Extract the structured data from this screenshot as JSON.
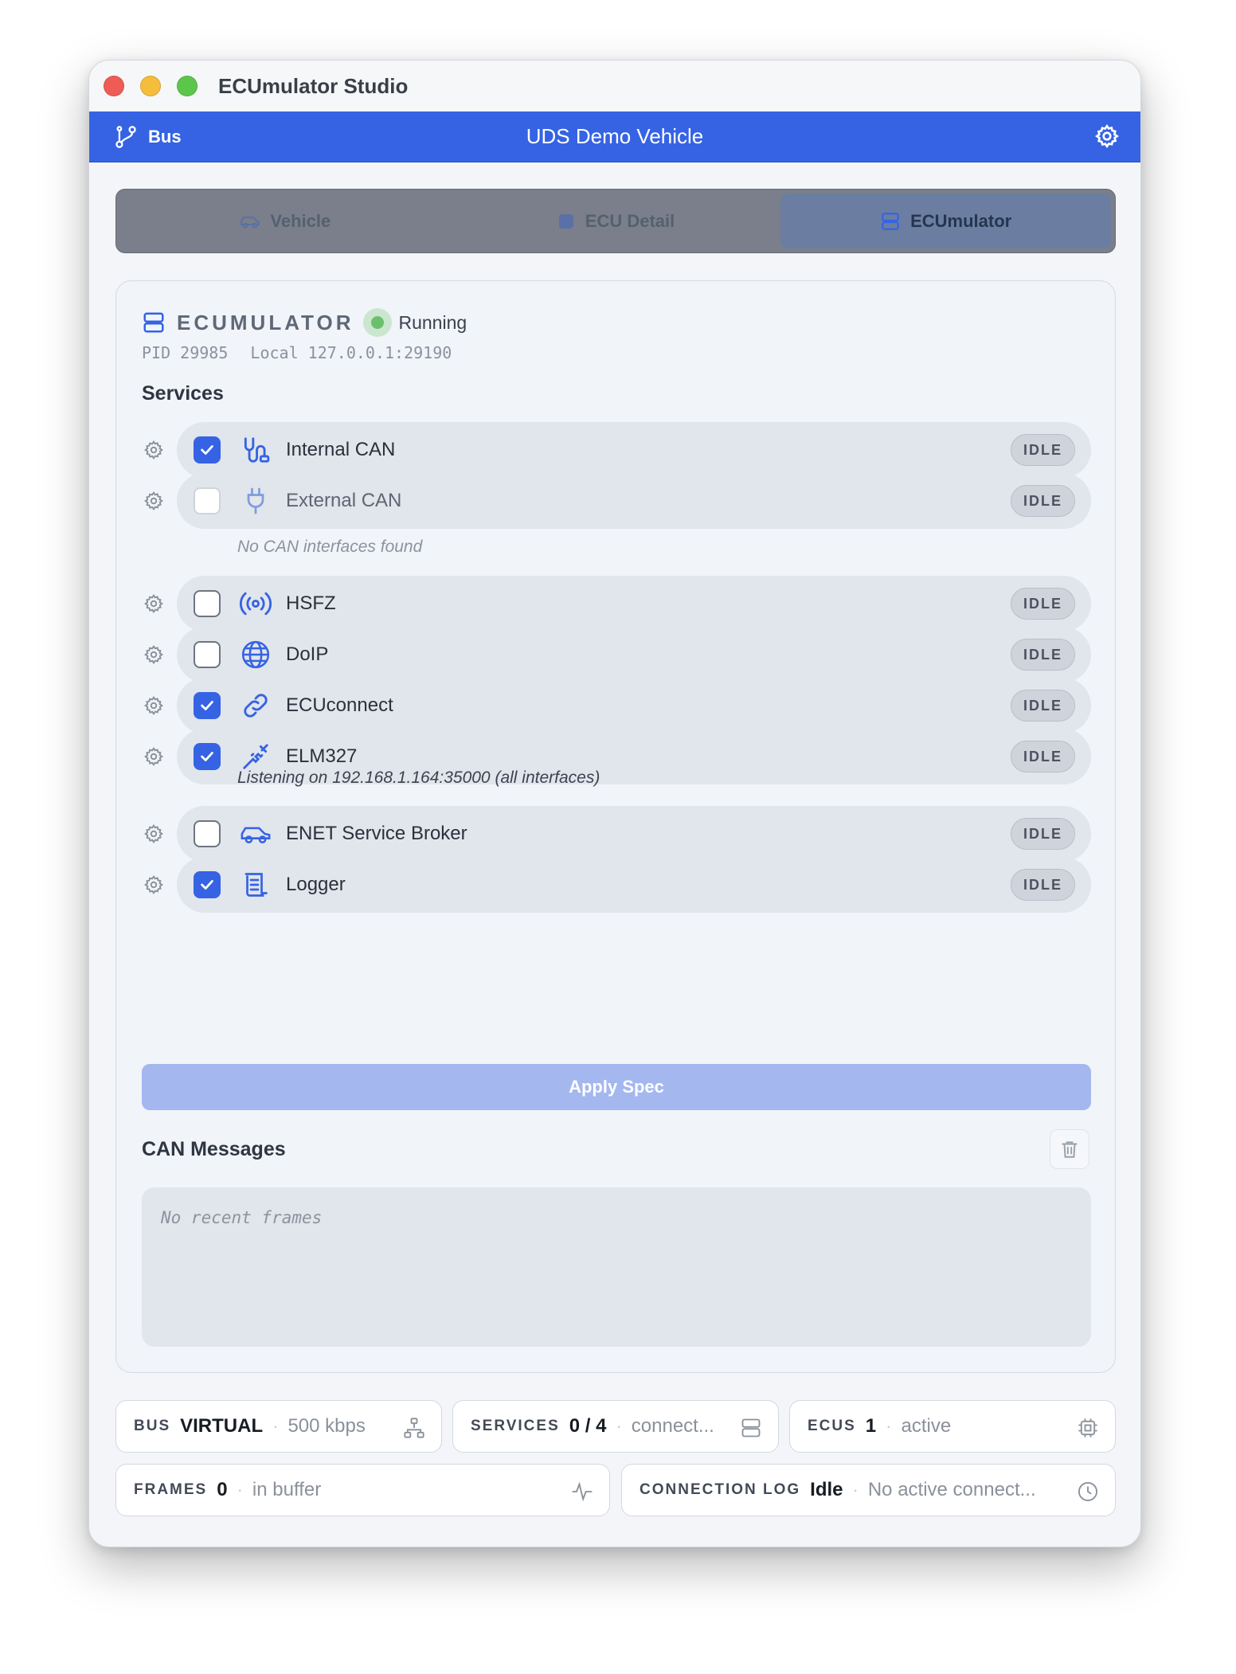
{
  "window": {
    "title": "ECUmulator Studio"
  },
  "header": {
    "bus_label": "Bus",
    "vehicle_name": "UDS Demo Vehicle"
  },
  "tabs": [
    {
      "label": "Vehicle",
      "icon": "car-icon",
      "active": false
    },
    {
      "label": "ECU Detail",
      "icon": "chip-icon",
      "active": false
    },
    {
      "label": "ECUmulator",
      "icon": "server-icon",
      "active": true
    }
  ],
  "ecumulator": {
    "title": "ECUMULATOR",
    "status": "Running",
    "status_color": "#6cbf6c",
    "pid": "PID 29985",
    "local": "Local 127.0.0.1:29190"
  },
  "services_title": "Services",
  "services": [
    {
      "name": "Internal CAN",
      "checked": true,
      "state": "IDLE",
      "icon": "can-plug-icon"
    },
    {
      "name": "External CAN",
      "checked": false,
      "disabled": true,
      "state": "IDLE",
      "icon": "plug-icon",
      "note": "No CAN interfaces found"
    },
    {
      "name": "HSFZ",
      "checked": false,
      "state": "IDLE",
      "icon": "broadcast-icon"
    },
    {
      "name": "DoIP",
      "checked": false,
      "state": "IDLE",
      "icon": "globe-icon"
    },
    {
      "name": "ECUconnect",
      "checked": true,
      "state": "IDLE",
      "icon": "link-icon"
    },
    {
      "name": "ELM327",
      "checked": true,
      "state": "IDLE",
      "icon": "cable-icon",
      "note": "Listening on 192.168.1.164:35000 (all interfaces)"
    },
    {
      "name": "ENET Service Broker",
      "checked": false,
      "state": "IDLE",
      "icon": "car-icon"
    },
    {
      "name": "Logger",
      "checked": true,
      "state": "IDLE",
      "icon": "scroll-icon"
    }
  ],
  "apply_label": "Apply Spec",
  "can_messages": {
    "title": "CAN Messages",
    "empty": "No recent frames"
  },
  "stats": {
    "bus": {
      "label": "BUS",
      "value": "VIRTUAL",
      "sub": "500 kbps"
    },
    "services": {
      "label": "SERVICES",
      "value": "0 / 4",
      "sub": "connect..."
    },
    "ecus": {
      "label": "ECUS",
      "value": "1",
      "sub": "active"
    },
    "frames": {
      "label": "FRAMES",
      "value": "0",
      "sub": "in buffer"
    },
    "connection_log": {
      "label": "CONNECTION LOG",
      "value": "Idle",
      "sub": "No active connect..."
    }
  },
  "colors": {
    "accent": "#3563e3",
    "window_bg": "#f3f5f9",
    "pill_bg": "#e1e5ec"
  }
}
